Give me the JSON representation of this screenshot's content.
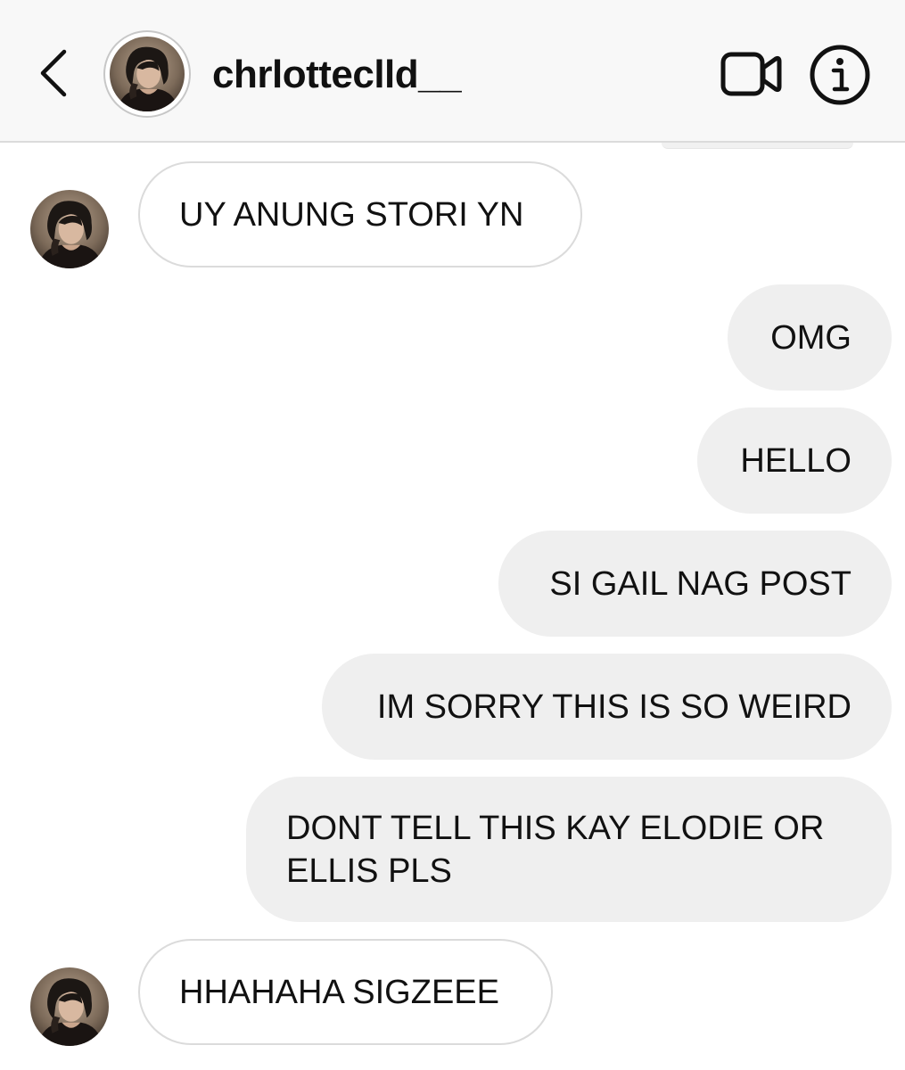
{
  "header": {
    "username": "chrlotteclld__",
    "colors": {
      "background": "#f8f8f8",
      "divider": "#dbdbdb",
      "icon": "#111111"
    },
    "icons": {
      "back": "chevron-left-icon",
      "video": "video-camera-icon",
      "info": "info-icon"
    }
  },
  "messages": [
    {
      "direction": "incoming",
      "text": "UY ANUNG STORI YN"
    },
    {
      "direction": "outgoing",
      "text": "OMG"
    },
    {
      "direction": "outgoing",
      "text": "HELLO"
    },
    {
      "direction": "outgoing",
      "text": "SI GAIL NAG POST"
    },
    {
      "direction": "outgoing",
      "text": "IM SORRY THIS IS SO WEIRD"
    },
    {
      "direction": "outgoing",
      "text": "DONT TELL THIS KAY ELODIE OR ELLIS PLS"
    },
    {
      "direction": "incoming",
      "text": "HHAHAHA SIGZEEE"
    }
  ],
  "colors": {
    "incoming_bubble": "#ffffff",
    "incoming_border": "#dbdbdb",
    "outgoing_bubble": "#efefef",
    "text": "#111111"
  }
}
